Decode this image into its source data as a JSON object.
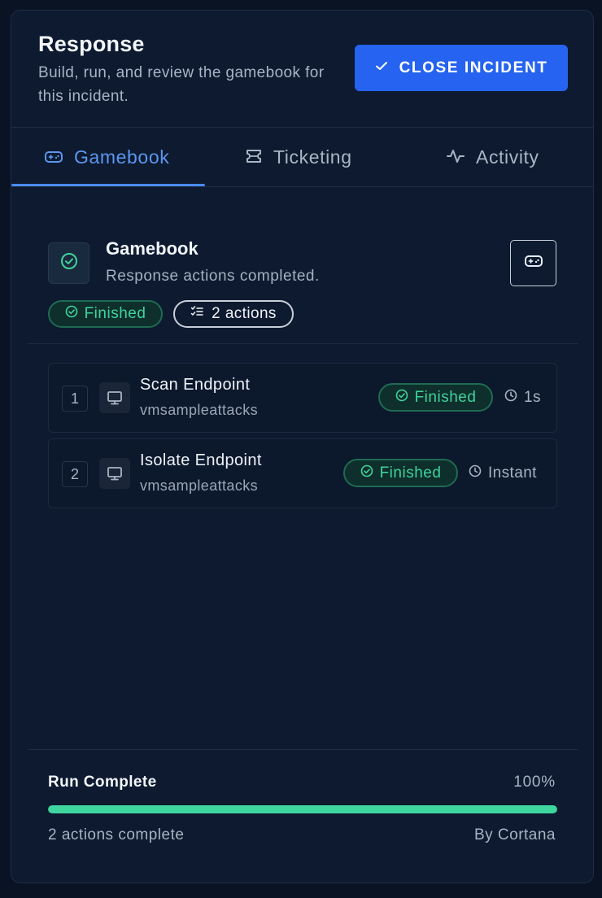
{
  "header": {
    "title": "Response",
    "subtitle": "Build, run, and review the gamebook for this incident.",
    "close_button_label": "CLOSE INCIDENT"
  },
  "tabs": [
    {
      "label": "Gamebook",
      "icon": "gamepad-icon",
      "active": true
    },
    {
      "label": "Ticketing",
      "icon": "ticket-icon",
      "active": false
    },
    {
      "label": "Activity",
      "icon": "activity-icon",
      "active": false
    }
  ],
  "gamebook": {
    "title": "Gamebook",
    "subtitle": "Response actions completed.",
    "status_label": "Finished",
    "actions_label": "2 actions"
  },
  "actions": [
    {
      "index": "1",
      "name": "Scan Endpoint",
      "host": "vmsampleattacks",
      "status": "Finished",
      "duration": "1s"
    },
    {
      "index": "2",
      "name": "Isolate Endpoint",
      "host": "vmsampleattacks",
      "status": "Finished",
      "duration": "Instant"
    }
  ],
  "run": {
    "title": "Run Complete",
    "percent_label": "100%",
    "progress": 1.0,
    "count_label": "2 actions complete",
    "by_label": "By Cortana"
  },
  "colors": {
    "accent": "#2563f0",
    "tab_active": "#5b97ee",
    "success": "#3fd49c",
    "background": "#0d1a30"
  }
}
